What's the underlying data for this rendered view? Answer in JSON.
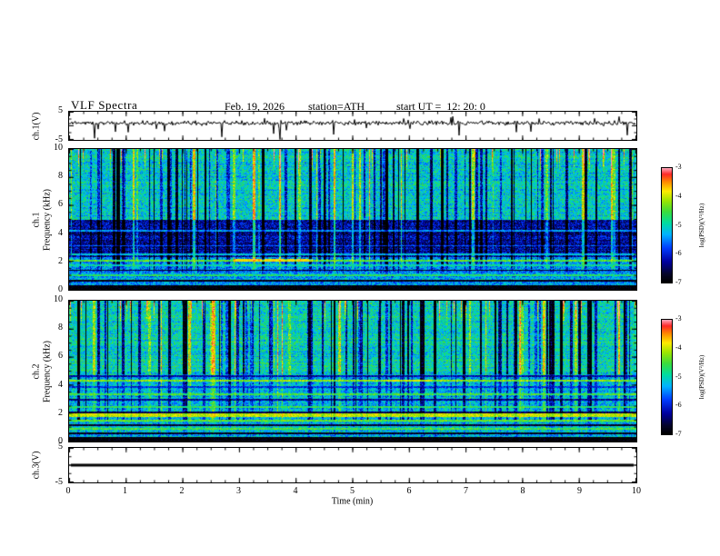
{
  "title": "VLF Spectra",
  "header": {
    "date": "Feb. 19, 2026",
    "station": "station=ATH",
    "start_ut": "start UT =  12: 20: 0"
  },
  "xaxis": {
    "label": "Time (min)",
    "lim": [
      0,
      10
    ],
    "ticks": [
      0,
      1,
      2,
      3,
      4,
      5,
      6,
      7,
      8,
      9,
      10
    ]
  },
  "colorbar": {
    "label": "log(PSD)(V²/Hz)",
    "lim": [
      -7,
      -3
    ],
    "ticks": [
      -3,
      -4,
      -5,
      -6,
      -7
    ],
    "colormap_stops": [
      {
        "t": 0.0,
        "color": "#000000"
      },
      {
        "t": 0.07,
        "color": "#050528"
      },
      {
        "t": 0.18,
        "color": "#0000a0"
      },
      {
        "t": 0.3,
        "color": "#003cff"
      },
      {
        "t": 0.42,
        "color": "#00b4ff"
      },
      {
        "t": 0.52,
        "color": "#00dca0"
      },
      {
        "t": 0.62,
        "color": "#3cdc3c"
      },
      {
        "t": 0.72,
        "color": "#a0e600"
      },
      {
        "t": 0.8,
        "color": "#ffeb00"
      },
      {
        "t": 0.88,
        "color": "#ff8c00"
      },
      {
        "t": 0.95,
        "color": "#ff2828"
      },
      {
        "t": 1.0,
        "color": "#ffa0b4"
      }
    ]
  },
  "chart_data": [
    {
      "id": "ch1-waveform",
      "type": "line",
      "ylabel": "ch.1(V)",
      "ylim": [
        -5,
        5
      ],
      "ytick_labels": [
        5,
        -5
      ],
      "yticks": [
        -5,
        0,
        5
      ],
      "xlim": [
        0,
        10
      ],
      "description": "Noisy voltage trace hovering near +1 V with dense jitter and frequent impulsive downward spikes reaching close to -5 V",
      "baseline": 1.0,
      "noise_amplitude": 0.45,
      "spike_probability": 0.035,
      "spike_max_depth": -4.8
    },
    {
      "id": "ch1-spectrogram",
      "type": "heatmap",
      "ylabel_channel": "ch.1",
      "ylabel_axis": "Frequency (kHz)",
      "ylim": [
        0,
        10
      ],
      "yticks": [
        0,
        2,
        4,
        6,
        8,
        10
      ],
      "xlim": [
        0,
        10
      ],
      "zlabel": "log(PSD)(V²/Hz)",
      "zlim": [
        -7,
        -3
      ],
      "description": "VLF spectrogram: green band above 5 kHz crossed by many vertical impulsive streaks (dark blue and occasional red-topped), deep blue band 2.3-5 kHz, layered horizontal emission lines below 2.3 kHz, black band near 0 kHz",
      "bands": [
        {
          "f_range": [
            5,
            10
          ],
          "level": -5.1
        },
        {
          "f_range": [
            2.3,
            5
          ],
          "level": -6.3
        },
        {
          "f_range": [
            0,
            2.3
          ],
          "level": -5.4
        }
      ],
      "hlines": [
        {
          "f": 0.15,
          "halfwidth": 0.15,
          "level": -7.0
        },
        {
          "f": 0.6,
          "halfwidth": 0.06,
          "level": -6.9
        },
        {
          "f": 1.0,
          "halfwidth": 0.06,
          "level": -4.7
        },
        {
          "f": 1.35,
          "halfwidth": 0.05,
          "level": -6.8
        },
        {
          "f": 1.7,
          "halfwidth": 0.06,
          "level": -4.9
        },
        {
          "f": 2.05,
          "halfwidth": 0.09,
          "level": -4.4
        },
        {
          "f": 2.5,
          "halfwidth": 0.05,
          "level": -5.1
        },
        {
          "f": 3.1,
          "halfwidth": 0.04,
          "level": -5.7
        },
        {
          "f": 4.2,
          "halfwidth": 0.05,
          "level": -5.4
        }
      ],
      "segments": [
        {
          "f": 2.05,
          "halfwidth": 0.1,
          "x_range": [
            2.9,
            4.3
          ],
          "level": -3.8
        }
      ],
      "impulse_column_fraction": 0.35
    },
    {
      "id": "ch2-spectrogram",
      "type": "heatmap",
      "ylabel_channel": "ch.2",
      "ylabel_axis": "Frequency (kHz)",
      "ylim": [
        0,
        10
      ],
      "yticks": [
        0,
        2,
        4,
        6,
        8,
        10
      ],
      "xlim": [
        0,
        10
      ],
      "zlabel": "log(PSD)(V²/Hz)",
      "zlim": [
        -7,
        -3
      ],
      "description": "VLF spectrogram: green band above 5 kHz with vertical impulsive streaks, greenish-yellow region below 5 kHz ruled by many horizontal lines (bright yellow near 1.9 and 4.3 kHz, dark lines interleaved), black band near 0 kHz",
      "bands": [
        {
          "f_range": [
            5,
            10
          ],
          "level": -5.0
        },
        {
          "f_range": [
            0,
            5
          ],
          "level": -5.2
        }
      ],
      "hlines": [
        {
          "f": 0.15,
          "halfwidth": 0.15,
          "level": -7.0
        },
        {
          "f": 0.55,
          "halfwidth": 0.06,
          "level": -6.8
        },
        {
          "f": 0.85,
          "halfwidth": 0.06,
          "level": -4.5
        },
        {
          "f": 1.15,
          "halfwidth": 0.05,
          "level": -6.7
        },
        {
          "f": 1.45,
          "halfwidth": 0.06,
          "level": -4.4
        },
        {
          "f": 1.85,
          "halfwidth": 0.1,
          "level": -4.0
        },
        {
          "f": 2.05,
          "halfwidth": 0.07,
          "level": -6.6
        },
        {
          "f": 2.45,
          "halfwidth": 0.05,
          "level": -4.6
        },
        {
          "f": 2.95,
          "halfwidth": 0.05,
          "level": -6.3
        },
        {
          "f": 3.35,
          "halfwidth": 0.05,
          "level": -4.5
        },
        {
          "f": 3.85,
          "halfwidth": 0.05,
          "level": -5.9
        },
        {
          "f": 4.3,
          "halfwidth": 0.06,
          "level": -4.2
        },
        {
          "f": 4.65,
          "halfwidth": 0.05,
          "level": -6.2
        }
      ],
      "segments": [
        {
          "f": 1.9,
          "halfwidth": 0.08,
          "x_range": [
            0.2,
            1.3
          ],
          "level": -3.9
        },
        {
          "f": 4.3,
          "halfwidth": 0.06,
          "x_range": [
            5.6,
            6.4
          ],
          "level": -3.9
        }
      ],
      "impulse_column_fraction": 0.35
    },
    {
      "id": "ch3-waveform",
      "type": "line",
      "ylabel": "ch.3(V)",
      "ylim": [
        -5,
        5
      ],
      "ytick_labels": [
        5,
        -5
      ],
      "yticks": [
        -5,
        0,
        5
      ],
      "xlim": [
        0,
        10
      ],
      "description": "Flat thick black line at 0 V for the whole interval (channel inactive)",
      "baseline": 0
    }
  ]
}
